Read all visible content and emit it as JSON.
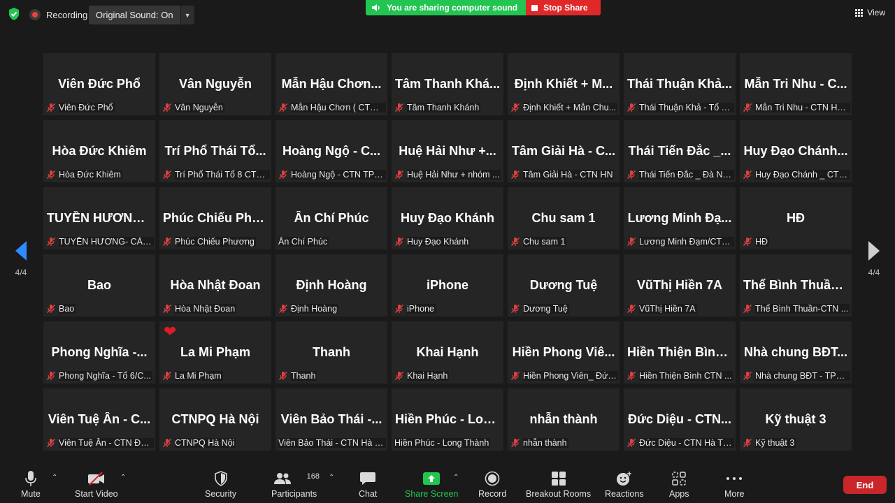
{
  "topbar": {
    "recording_label": "Recording",
    "original_sound": "Original Sound: On",
    "share_message": "You are sharing computer sound",
    "stop_share": "Stop Share",
    "view_label": "View"
  },
  "nav": {
    "left_page": "4/4",
    "right_page": "4/4"
  },
  "colors": {
    "share_green": "#23c552",
    "stop_red": "#e02828",
    "accent_blue": "#2d8cff",
    "end_red": "#c9262a"
  },
  "tiles": [
    {
      "big": "Viên Đức Phổ",
      "name": "Viên Đức Phổ"
    },
    {
      "big": "Vân Nguyễn",
      "name": "Vân Nguyễn"
    },
    {
      "big": "Mẫn Hậu Chơn...",
      "name": "Mẫn Hậu Chơn ( CTN_..."
    },
    {
      "big": "Tâm Thanh Khá...",
      "name": "Tâm Thanh Khánh"
    },
    {
      "big": "Định Khiết + M...",
      "name": "Định Khiết + Mẫn Chu..."
    },
    {
      "big": "Thái Thuận Khả...",
      "name": "Thái Thuận Khả - Tổ 5 ..."
    },
    {
      "big": "Mẫn Tri Nhu - C...",
      "name": "Mẫn Tri Nhu - CTN HC..."
    },
    {
      "big": "Hòa Đức Khiêm",
      "name": "Hòa Đức Khiêm"
    },
    {
      "big": "Trí Phổ Thái Tổ...",
      "name": "Trí Phổ Thái Tổ 8 CTN..."
    },
    {
      "big": "Hoàng Ngộ - C...",
      "name": "Hoàng Ngộ - CTN TPH..."
    },
    {
      "big": "Huệ Hải Như +...",
      "name": "Huệ Hải Như + nhóm ..."
    },
    {
      "big": "Tâm Giải Hà - C...",
      "name": "Tâm Giải Hà - CTN HN"
    },
    {
      "big": "Thái Tiến Đắc _...",
      "name": "Thái Tiến Đắc _ Đà Nẵ..."
    },
    {
      "big": "Huy Đạo Chánh...",
      "name": "Huy Đạo Chánh _ CTN ..."
    },
    {
      "big": "TUYỀN HƯƠNG...",
      "name": "TUYỀN HƯƠNG- CÀ M..."
    },
    {
      "big": "Phúc Chiếu Phư...",
      "name": "Phúc Chiếu Phương"
    },
    {
      "big": "Ân Chí Phúc",
      "name": "Ân Chí Phúc",
      "nomic": true
    },
    {
      "big": "Huy Đạo Khánh",
      "name": "Huy Đạo Khánh"
    },
    {
      "big": "Chu sam 1",
      "name": "Chu sam 1"
    },
    {
      "big": "Lương Minh Đạ...",
      "name": "Lương Minh Đạm/CTN..."
    },
    {
      "big": "HĐ",
      "name": "HĐ"
    },
    {
      "big": "Bao",
      "name": "Bao"
    },
    {
      "big": "Hòa Nhật Đoan",
      "name": "Hòa Nhật Đoan"
    },
    {
      "big": "Định Hoàng",
      "name": "Định Hoàng"
    },
    {
      "big": "iPhone",
      "name": "iPhone"
    },
    {
      "big": "Dương Tuệ",
      "name": "Dương Tuệ"
    },
    {
      "big": "VũThị Hiền 7A",
      "name": "VũThị Hiền 7A"
    },
    {
      "big": "Thể Bình Thuần...",
      "name": "Thể Bình Thuần-CTN ..."
    },
    {
      "big": "Phong Nghĩa -...",
      "name": "Phong Nghĩa - Tổ 6/C..."
    },
    {
      "big": "La Mi Phạm",
      "name": "La Mi Phạm",
      "heart": true
    },
    {
      "big": "Thanh",
      "name": "Thanh"
    },
    {
      "big": "Khai Hạnh",
      "name": "Khai Hạnh"
    },
    {
      "big": "Hiền Phong Viê...",
      "name": "Hiền Phong Viên_ Đức..."
    },
    {
      "big": "Hiền Thiện Bình...",
      "name": "Hiền Thiện Bình CTN ..."
    },
    {
      "big": "Nhà chung BĐT...",
      "name": "Nhà chung BĐT - TPH..."
    },
    {
      "big": "Viên Tuệ Ân - C...",
      "name": "Viên Tuệ Ân - CTN Đài..."
    },
    {
      "big": "CTNPQ Hà Nội",
      "name": "CTNPQ Hà Nội"
    },
    {
      "big": "Viên Bảo Thái -...",
      "name": "Viên Bảo Thái - CTN Hà N...",
      "nomic": true
    },
    {
      "big": "Hiền Phúc - Lon...",
      "name": "Hiền Phúc - Long Thành",
      "nomic": true
    },
    {
      "big": "nhẫn thành",
      "name": "nhẫn thành"
    },
    {
      "big": "Đức Diệu - CTN...",
      "name": "Đức Diệu - CTN Hà Tĩnh"
    },
    {
      "big": "Kỹ thuật 3",
      "name": "Kỹ thuật 3"
    }
  ],
  "toolbar": {
    "mute": "Mute",
    "start_video": "Start Video",
    "security": "Security",
    "participants_count": "168",
    "participants": "Participants",
    "chat": "Chat",
    "share_screen": "Share Screen",
    "record": "Record",
    "breakout_rooms": "Breakout Rooms",
    "reactions": "Reactions",
    "apps": "Apps",
    "more": "More",
    "end": "End"
  }
}
